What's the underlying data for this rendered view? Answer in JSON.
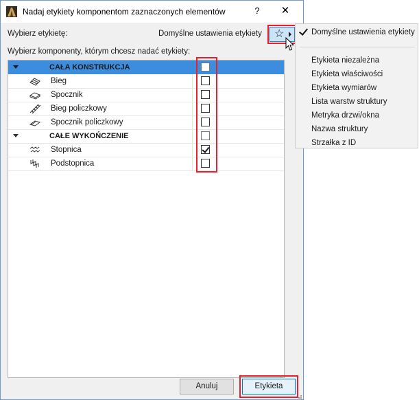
{
  "window": {
    "title": "Nadaj etykiety komponentom zaznaczonych elementów",
    "help_label": "?",
    "close_label": "✕"
  },
  "label_select": {
    "prompt": "Wybierz etykietę:",
    "current_value": "Domyślne ustawienia etykiety",
    "favorites_icon": "star-icon"
  },
  "components": {
    "prompt": "Wybierz komponenty, którym chcesz nadać etykiety:",
    "groups": [
      {
        "label": "CAŁA KONSTRUKCJA",
        "selected": true,
        "checked": false,
        "partial": true,
        "items": [
          {
            "label": "Bieg",
            "icon": "stair-run-icon",
            "checked": false
          },
          {
            "label": "Spocznik",
            "icon": "landing-icon",
            "checked": false
          },
          {
            "label": "Bieg policzkowy",
            "icon": "stringer-run-icon",
            "checked": false
          },
          {
            "label": "Spocznik policzkowy",
            "icon": "stringer-landing-icon",
            "checked": false
          }
        ]
      },
      {
        "label": "CAŁE WYKOŃCZENIE",
        "selected": false,
        "checked": false,
        "partial": true,
        "items": [
          {
            "label": "Stopnica",
            "icon": "tread-icon",
            "checked": true
          },
          {
            "label": "Podstopnica",
            "icon": "riser-icon",
            "checked": false
          }
        ]
      }
    ]
  },
  "buttons": {
    "cancel": "Anuluj",
    "ok": "Etykieta"
  },
  "dropdown_menu": {
    "checked_item": "Domyślne ustawienia etykiety",
    "items": [
      "Etykieta niezależna",
      "Etykieta właściwości",
      "Etykieta wymiarów",
      "Lista warstw struktury",
      "Metryka drzwi/okna",
      "Nazwa struktury",
      "Strzałka z ID"
    ]
  },
  "colors": {
    "selection": "#3c8ddd",
    "highlight_border": "#e8202e",
    "default_button_border": "#0078d7"
  }
}
